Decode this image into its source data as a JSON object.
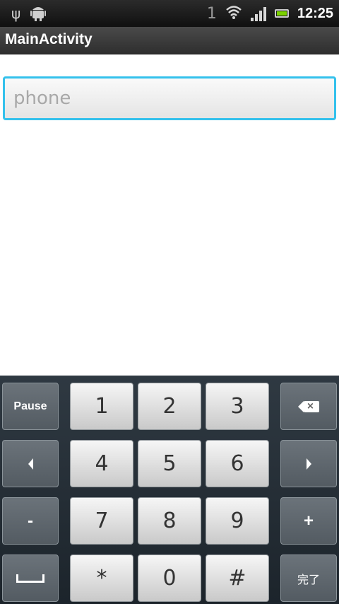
{
  "status_bar": {
    "notification_count": "1",
    "time": "12:25",
    "icons": [
      "usb-icon",
      "android-icon",
      "wifi-icon",
      "signal-icon",
      "battery-icon"
    ],
    "battery_color": "#7bd200"
  },
  "title_bar": {
    "title": "MainActivity"
  },
  "phone_input": {
    "placeholder": "phone",
    "value": "",
    "focus_color": "#34c1ec"
  },
  "keyboard": {
    "row1": {
      "left": "Pause",
      "keys": [
        "1",
        "2",
        "3"
      ],
      "right_icon": "backspace-icon"
    },
    "row2": {
      "left_icon": "arrow-left-icon",
      "keys": [
        "4",
        "5",
        "6"
      ],
      "right_icon": "arrow-right-icon"
    },
    "row3": {
      "left": "-",
      "keys": [
        "7",
        "8",
        "9"
      ],
      "right": "+"
    },
    "row4": {
      "left_icon": "space-icon",
      "keys": [
        "*",
        "0",
        "#"
      ],
      "right": "完了"
    }
  }
}
